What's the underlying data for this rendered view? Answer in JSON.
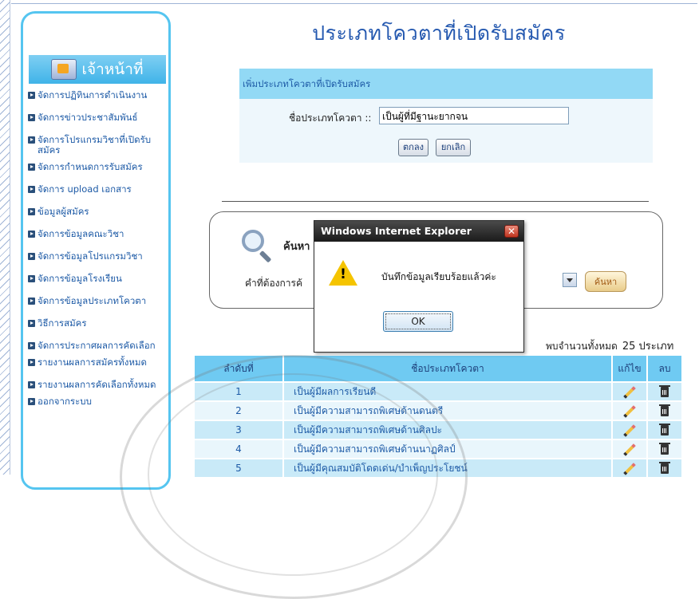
{
  "page": {
    "title": "ประเภทโควตาที่เปิดรับสมัคร"
  },
  "sidebar": {
    "title": "เจ้าหน้าที่",
    "items": [
      {
        "label": "จัดการปฏิทินการดำเนินงาน"
      },
      {
        "label": "จัดการข่าวประชาสัมพันธ์"
      },
      {
        "label": "จัดการโปรแกรมวิชาที่เปิดรับสมัคร"
      },
      {
        "label": "จัดการกำหนดการรับสมัคร"
      },
      {
        "label": "จัดการ upload เอกสาร"
      },
      {
        "label": "ข้อมูลผู้สมัคร"
      },
      {
        "label": "จัดการข้อมูลคณะวิชา"
      },
      {
        "label": "จัดการข้อมูลโปรแกรมวิชา"
      },
      {
        "label": "จัดการข้อมูลโรงเรียน"
      },
      {
        "label": "จัดการข้อมูลประเภทโควตา"
      },
      {
        "label": "วิธีการสมัคร"
      },
      {
        "label": "จัดการประกาศผลการคัดเลือก"
      },
      {
        "label": "รายงานผลการสมัครทั้งหมด"
      },
      {
        "label": "รายงานผลการคัดเลือกทั้งหมด"
      },
      {
        "label": "ออกจากระบบ"
      }
    ]
  },
  "add_form": {
    "heading": "เพิ่มประเภทโควตาที่เปิดรับสมัคร",
    "field_label": "ชื่อประเภทโควตา ::",
    "field_value": "เป็นผู้ที่มีฐานะยากจน",
    "ok_label": "ตกลง",
    "cancel_label": "ยกเลิก"
  },
  "search": {
    "heading": "ค้นหา",
    "label": "คำที่ต้องการค้",
    "button_label": "ค้นหา"
  },
  "results": {
    "count_label": "พบจำนวนทั้งหมด",
    "count_value": "25 ประเภท"
  },
  "table": {
    "headers": {
      "order": "ลำดับที่",
      "name": "ชื่อประเภทโควตา",
      "edit": "แก้ไข",
      "delete": "ลบ"
    },
    "rows": [
      {
        "num": "1",
        "name": "เป็นผู้มีผลการเรียนดี"
      },
      {
        "num": "2",
        "name": "เป็นผู้มีความสามารถพิเศษด้านดนตรี"
      },
      {
        "num": "3",
        "name": "เป็นผู้มีความสามารถพิเศษด้านศิลปะ"
      },
      {
        "num": "4",
        "name": "เป็นผู้มีความสามารถพิเศษด้านนาฏศิลป์"
      },
      {
        "num": "5",
        "name": "เป็นผู้มีคุณสมบัติโดดเด่น/บำเพ็ญประโยชน์"
      }
    ]
  },
  "dialog": {
    "title": "Windows Internet Explorer",
    "close": "✕",
    "message": "บันทึกข้อมูลเรียบร้อยแล้วค่ะ",
    "warning_mark": "!",
    "ok_label": "OK"
  },
  "colors": {
    "accent": "#55c5f0",
    "header_blue": "#6fcaf2",
    "link_blue": "#1d5aa6",
    "title_blue": "#2559b0"
  }
}
